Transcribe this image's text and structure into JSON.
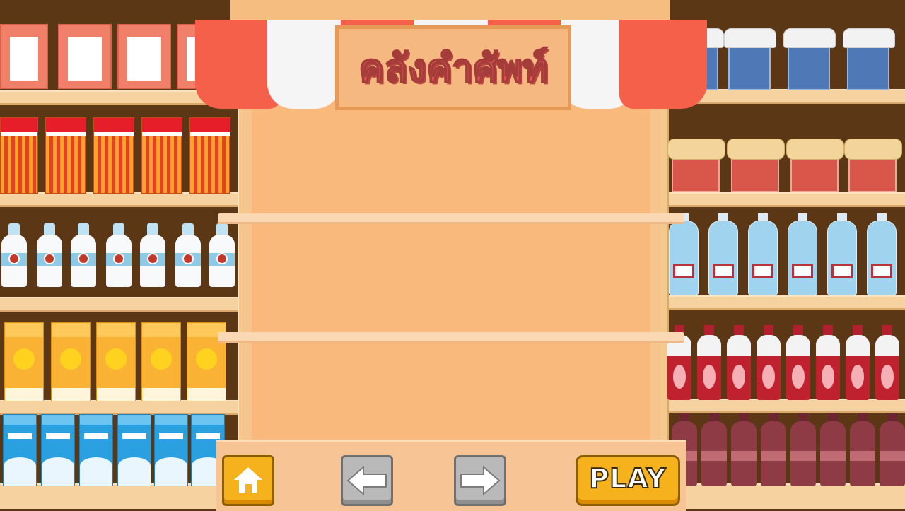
{
  "title": "คลังคำศัพท์",
  "buttons": {
    "home_icon": "home-icon",
    "prev_icon": "arrow-left-icon",
    "next_icon": "arrow-right-icon",
    "play_label": "PLAY"
  },
  "colors": {
    "shelf_brown": "#5b3716",
    "booth_orange": "#f9b97c",
    "awning_red": "#f5604a",
    "title_red": "#e9575a",
    "button_yellow": "#f6b21c",
    "button_gray": "#b9b9b9"
  }
}
